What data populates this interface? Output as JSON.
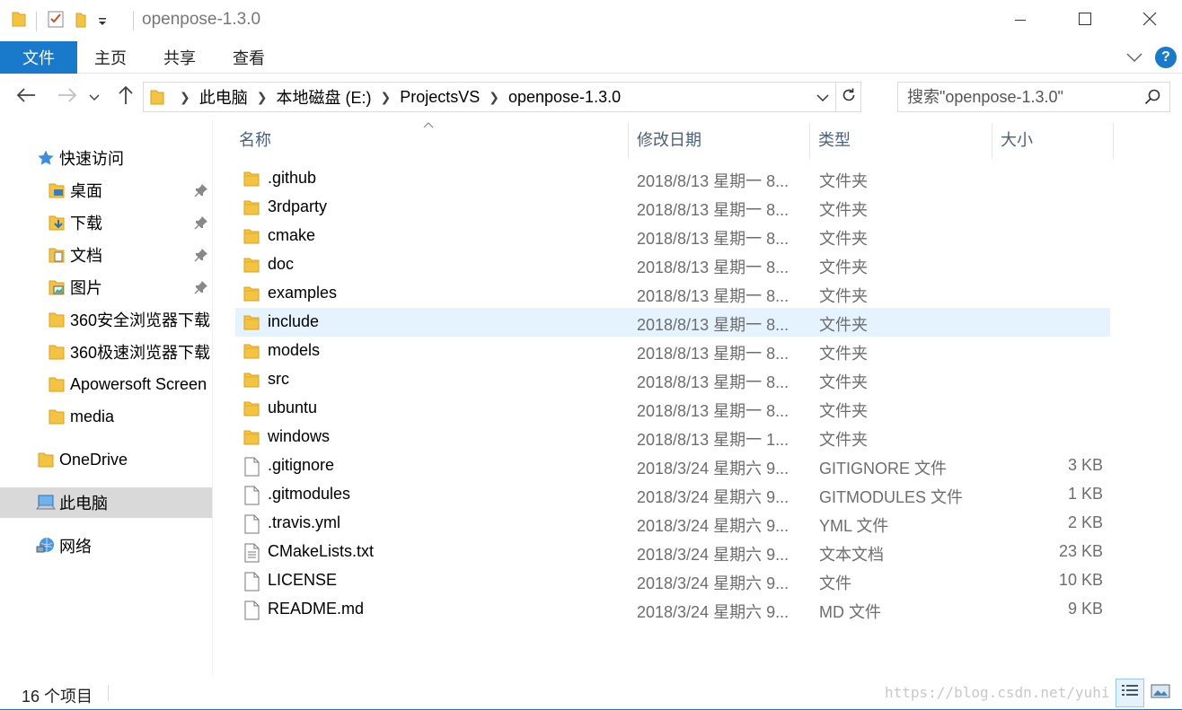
{
  "window": {
    "title": "openpose-1.3.0",
    "qat_icons": [
      "folder-icon",
      "properties-check-icon",
      "new-folder-icon",
      "customize-dropdown-icon"
    ]
  },
  "ribbon": {
    "tabs": [
      {
        "label": "文件",
        "active": true
      },
      {
        "label": "主页"
      },
      {
        "label": "共享"
      },
      {
        "label": "查看"
      }
    ],
    "help_label": "?"
  },
  "address": {
    "crumbs": [
      "此电脑",
      "本地磁盘 (E:)",
      "ProjectsVS",
      "openpose-1.3.0"
    ]
  },
  "search": {
    "placeholder": "搜索\"openpose-1.3.0\""
  },
  "sidebar": {
    "quick_access": "快速访问",
    "quick_items": [
      {
        "label": "桌面",
        "pinned": true,
        "icon": "desktop-folder-icon"
      },
      {
        "label": "下载",
        "pinned": true,
        "icon": "downloads-folder-icon"
      },
      {
        "label": "文档",
        "pinned": true,
        "icon": "documents-folder-icon"
      },
      {
        "label": "图片",
        "pinned": true,
        "icon": "pictures-folder-icon"
      },
      {
        "label": "360安全浏览器下载",
        "pinned": false,
        "icon": "folder-icon"
      },
      {
        "label": "360极速浏览器下载",
        "pinned": false,
        "icon": "folder-icon"
      },
      {
        "label": "Apowersoft Screen",
        "pinned": false,
        "icon": "folder-icon"
      },
      {
        "label": "media",
        "pinned": false,
        "icon": "folder-icon"
      }
    ],
    "onedrive": "OneDrive",
    "this_pc": "此电脑",
    "network": "网络"
  },
  "columns": {
    "name": "名称",
    "date": "修改日期",
    "type": "类型",
    "size": "大小"
  },
  "files": [
    {
      "name": ".github",
      "date": "2018/8/13 星期一 8...",
      "type": "文件夹",
      "size": "",
      "kind": "folder"
    },
    {
      "name": "3rdparty",
      "date": "2018/8/13 星期一 8...",
      "type": "文件夹",
      "size": "",
      "kind": "folder"
    },
    {
      "name": "cmake",
      "date": "2018/8/13 星期一 8...",
      "type": "文件夹",
      "size": "",
      "kind": "folder"
    },
    {
      "name": "doc",
      "date": "2018/8/13 星期一 8...",
      "type": "文件夹",
      "size": "",
      "kind": "folder"
    },
    {
      "name": "examples",
      "date": "2018/8/13 星期一 8...",
      "type": "文件夹",
      "size": "",
      "kind": "folder"
    },
    {
      "name": "include",
      "date": "2018/8/13 星期一 8...",
      "type": "文件夹",
      "size": "",
      "kind": "folder",
      "hover": true
    },
    {
      "name": "models",
      "date": "2018/8/13 星期一 8...",
      "type": "文件夹",
      "size": "",
      "kind": "folder"
    },
    {
      "name": "src",
      "date": "2018/8/13 星期一 8...",
      "type": "文件夹",
      "size": "",
      "kind": "folder"
    },
    {
      "name": "ubuntu",
      "date": "2018/8/13 星期一 8...",
      "type": "文件夹",
      "size": "",
      "kind": "folder"
    },
    {
      "name": "windows",
      "date": "2018/8/13 星期一 1...",
      "type": "文件夹",
      "size": "",
      "kind": "folder"
    },
    {
      "name": ".gitignore",
      "date": "2018/3/24 星期六 9...",
      "type": "GITIGNORE 文件",
      "size": "3 KB",
      "kind": "file"
    },
    {
      "name": ".gitmodules",
      "date": "2018/3/24 星期六 9...",
      "type": "GITMODULES 文件",
      "size": "1 KB",
      "kind": "file"
    },
    {
      "name": ".travis.yml",
      "date": "2018/3/24 星期六 9...",
      "type": "YML 文件",
      "size": "2 KB",
      "kind": "file"
    },
    {
      "name": "CMakeLists.txt",
      "date": "2018/3/24 星期六 9...",
      "type": "文本文档",
      "size": "23 KB",
      "kind": "text"
    },
    {
      "name": "LICENSE",
      "date": "2018/3/24 星期六 9...",
      "type": "文件",
      "size": "10 KB",
      "kind": "file"
    },
    {
      "name": "README.md",
      "date": "2018/3/24 星期六 9...",
      "type": "MD 文件",
      "size": "9 KB",
      "kind": "file"
    }
  ],
  "status": {
    "item_count": "16 个项目",
    "watermark": "https://blog.csdn.net/yuhi"
  },
  "colors": {
    "accent": "#1979ca",
    "folder": "#f5c342",
    "hover_row": "#e5f3ff",
    "selected_nav": "#d9d9d9"
  }
}
